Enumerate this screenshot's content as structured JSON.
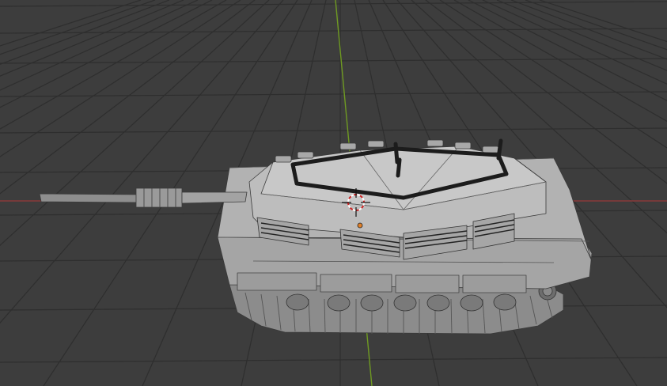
{
  "app": {
    "name": "3D viewport",
    "view": "perspective"
  },
  "viewport": {
    "background_color": "#3d3d3d",
    "grid_line_color": "#2e2e2e",
    "x_axis_color": "#8a3a3a",
    "y_axis_color": "#6f9a22"
  },
  "scene": {
    "objects": [
      {
        "name": "tank-model",
        "display": "solid",
        "selected": false,
        "base_color": "#9a9a9a"
      }
    ]
  },
  "overlays": {
    "cursor_3d": {
      "name": "3d-cursor-icon",
      "ring_colors": [
        "#cc2222",
        "#ffffff"
      ]
    },
    "origin_point": {
      "name": "object-origin-point",
      "color": "#e0802a"
    }
  }
}
